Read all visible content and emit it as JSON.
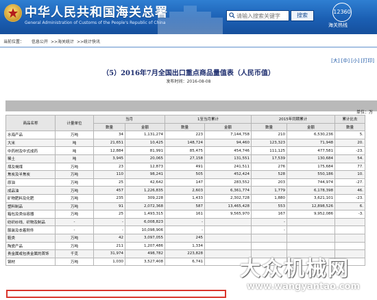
{
  "header": {
    "title_cn": "中华人民共和国海关总署",
    "title_en": "General Administration of Customs of the People's Republic of China",
    "search": {
      "placeholder": "请输入搜索关键字",
      "button": "搜索"
    },
    "hotline": {
      "number": "12360",
      "label": "海关热线"
    }
  },
  "breadcrumb": {
    "label": "当前位置：",
    "items": [
      "信息公开",
      ">>海关统计",
      ">>统计快讯"
    ]
  },
  "font_size": {
    "items": [
      "[大]",
      "[中]",
      "[小]",
      "[打印]"
    ]
  },
  "page": {
    "title": "（5）2016年7月全国出口重点商品量值表（人民币值）",
    "publish_label": "发布时间：",
    "publish_date": "2016-08-08"
  },
  "table": {
    "unit": "单位：万",
    "headers": {
      "name": "商品名称",
      "unit": "计量单位",
      "month": "当月",
      "ytd": "1至当月累计",
      "prev": "2015年同期累计",
      "cmp": "累计比去",
      "qty": "数量",
      "amt": "金额"
    },
    "rows": [
      [
        "水海产品",
        "万吨",
        "34",
        "1,131,274",
        "223",
        "7,144,758",
        "210",
        "6,530,236",
        "5."
      ],
      [
        "大米",
        "吨",
        "21,651",
        "10,425",
        "148,724",
        "94,460",
        "123,323",
        "71,948",
        "20."
      ],
      [
        "中药材及中式成药",
        "吨",
        "12,884",
        "81,991",
        "85,475",
        "454,746",
        "111,125",
        "477,581",
        "-23."
      ],
      [
        "稀土",
        "吨",
        "3,945",
        "20,065",
        "27,158",
        "131,551",
        "17,539",
        "130,684",
        "54."
      ],
      [
        "煤及褐煤",
        "万吨",
        "23",
        "12,873",
        "491",
        "241,511",
        "276",
        "175,684",
        "77."
      ],
      [
        "焦炭及半焦炭",
        "万吨",
        "110",
        "98,241",
        "505",
        "452,424",
        "528",
        "550,186",
        "10."
      ],
      [
        "原油",
        "万吨",
        "25",
        "42,642",
        "147",
        "283,552",
        "203",
        "744,974",
        "-27."
      ],
      [
        "成品油",
        "万吨",
        "457",
        "1,226,835",
        "2,603",
        "6,361,774",
        "1,779",
        "6,178,398",
        "46."
      ],
      [
        "矿物肥料及化肥",
        "万吨",
        "235",
        "309,228",
        "1,433",
        "2,302,728",
        "1,880",
        "3,621,101",
        "-23."
      ],
      [
        "塑料制品",
        "万吨",
        "91",
        "2,072,368",
        "587",
        "13,465,428",
        "553",
        "12,898,526",
        "6."
      ],
      [
        "箱包及类似容器",
        "万吨",
        "25",
        "1,493,315",
        "161",
        "9,565,970",
        "167",
        "9,952,086",
        "-3."
      ],
      [
        "纺织纱线、织物及制品",
        "-",
        "-",
        "6,008,823",
        "-",
        "",
        "-",
        "",
        ""
      ],
      [
        "服装及衣着附件",
        "-",
        "-",
        "10,098,906",
        "-",
        "",
        "-",
        "",
        ""
      ],
      [
        "鞋类",
        "万吨",
        "42",
        "3,097,055",
        "245",
        "",
        "",
        "",
        ""
      ],
      [
        "陶瓷产品",
        "万吨",
        "211",
        "1,207,486",
        "1,334",
        "",
        "",
        "",
        ""
      ],
      [
        "贵金属或包贵金属的首饰",
        "千克",
        "31,974",
        "498,782",
        "223,828",
        "",
        "",
        "",
        ""
      ],
      [
        "钢材",
        "万吨",
        "1,030",
        "3,527,408",
        "6,741",
        "",
        "",
        "",
        ""
      ]
    ]
  },
  "watermark": {
    "cn": "大众机械网",
    "en": "www.wangyantao.com"
  },
  "colors": {
    "header_blue": "#1b5fb3",
    "highlight_red": "#d9342b",
    "band_gray": "#b9b9b9"
  }
}
